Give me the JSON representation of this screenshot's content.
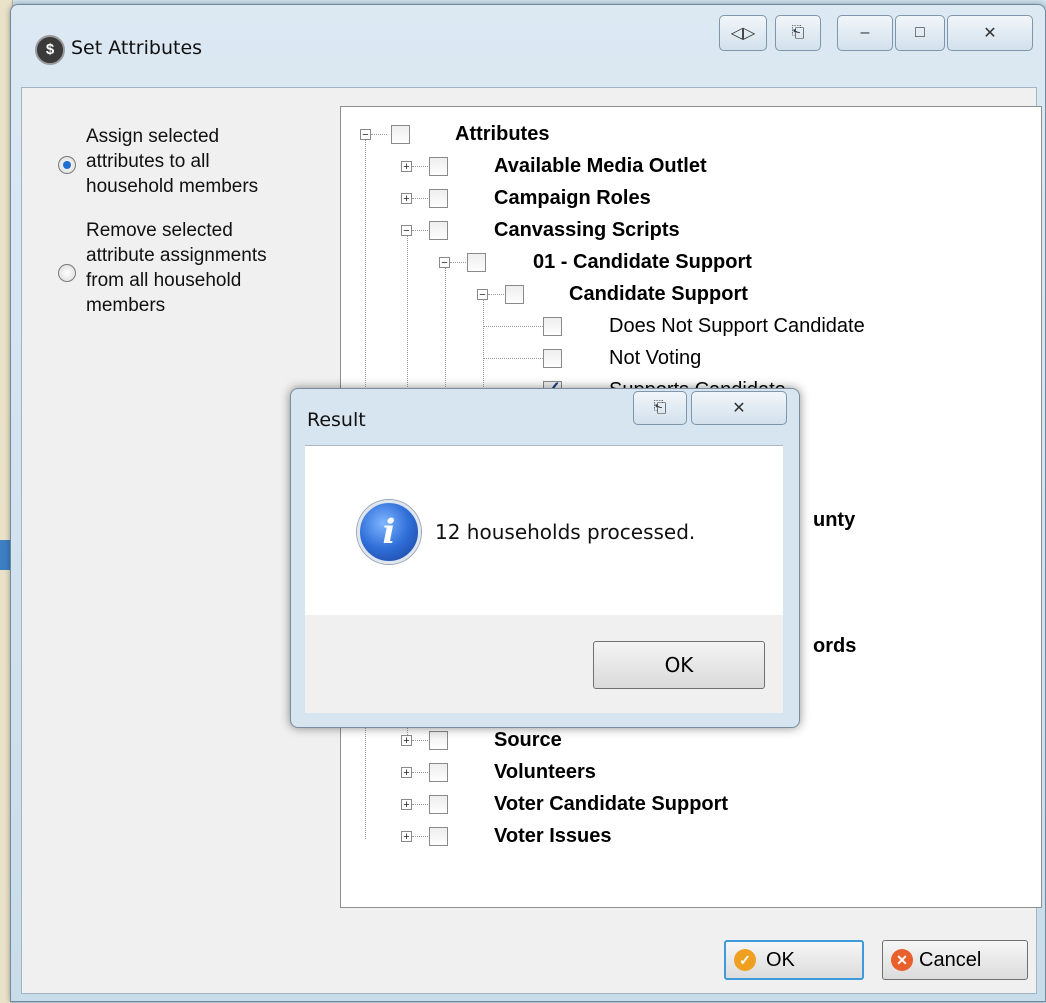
{
  "window": {
    "title": "Set Attributes",
    "app_icon_glyph": "$",
    "caption_buttons": [
      "◁▷",
      "⎗",
      "–",
      "□",
      "✕"
    ]
  },
  "options": {
    "assign": {
      "label_lines": [
        "Assign selected",
        "attributes to all",
        "household members"
      ],
      "checked": true
    },
    "remove": {
      "label_lines": [
        "Remove selected",
        "attribute assignments",
        "from all household",
        "members"
      ],
      "checked": false
    }
  },
  "tree": {
    "nodes": [
      {
        "label": "Attributes",
        "bold": true,
        "expander": "minus",
        "checked": false
      },
      {
        "label": "Available Media Outlet",
        "bold": true,
        "expander": "plus",
        "checked": false
      },
      {
        "label": "Campaign Roles",
        "bold": true,
        "expander": "plus",
        "checked": false
      },
      {
        "label": "Canvassing Scripts",
        "bold": true,
        "expander": "minus",
        "checked": false
      },
      {
        "label": "01 - Candidate Support",
        "bold": true,
        "expander": "minus",
        "checked": false
      },
      {
        "label": "Candidate Support",
        "bold": true,
        "expander": "minus",
        "checked": false
      },
      {
        "label": "Does Not Support Candidate",
        "bold": false,
        "expander": "none",
        "checked": false
      },
      {
        "label": "Not Voting",
        "bold": false,
        "expander": "none",
        "checked": false
      },
      {
        "label": "Supports Candidate",
        "bold": false,
        "expander": "none",
        "checked": true
      },
      {
        "label": "unty",
        "bold": true,
        "expander": "none",
        "checked": false
      },
      {
        "label": "ords",
        "bold": true,
        "expander": "none",
        "checked": false
      },
      {
        "label": "Source",
        "bold": true,
        "expander": "plus",
        "checked": false
      },
      {
        "label": "Volunteers",
        "bold": true,
        "expander": "plus",
        "checked": false
      },
      {
        "label": "Voter Candidate Support",
        "bold": true,
        "expander": "plus",
        "checked": false
      },
      {
        "label": "Voter Issues",
        "bold": true,
        "expander": "plus",
        "checked": false
      }
    ]
  },
  "buttons": {
    "ok": "OK",
    "cancel": "Cancel"
  },
  "dialog": {
    "title": "Result",
    "message": "12 households processed.",
    "ok": "OK",
    "icon_glyph": "i",
    "caption_buttons": [
      "⎗",
      "✕"
    ]
  },
  "colors": {
    "radio_accent": "#1e6fd0",
    "ok_icon": "#f0a020",
    "cancel_icon": "#e8602c",
    "info_icon": "#2f6ed8"
  }
}
